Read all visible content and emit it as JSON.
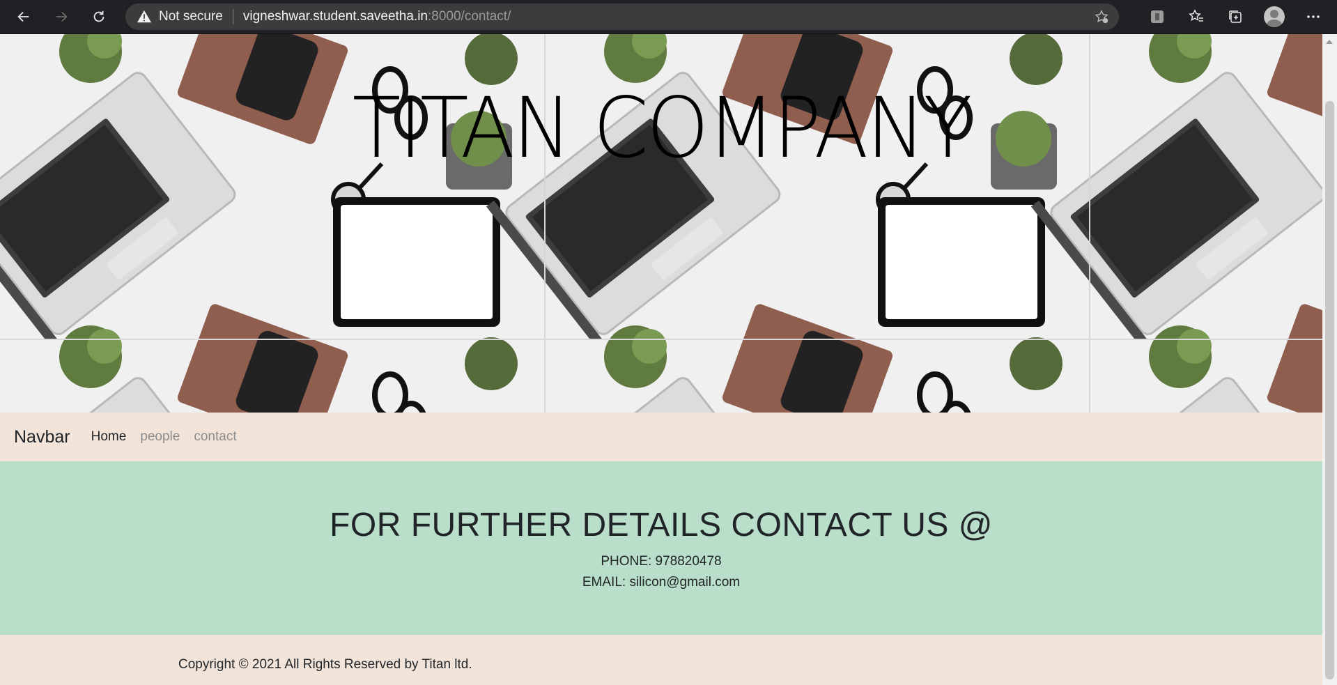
{
  "browser": {
    "security_label": "Not secure",
    "url_host": "vigneshwar.student.saveetha.in",
    "url_path": ":8000/contact/"
  },
  "hero": {
    "title": "TITAN COMPANY"
  },
  "navbar": {
    "brand": "Navbar",
    "links": [
      {
        "label": "Home",
        "active": true
      },
      {
        "label": "people",
        "active": false
      },
      {
        "label": "contact",
        "active": false
      }
    ]
  },
  "contact": {
    "heading": "FOR FURTHER DETAILS CONTACT US @",
    "phone": "PHONE: 978820478",
    "email": "EMAIL: silicon@gmail.com"
  },
  "footer": {
    "copyright": "Copyright © 2021 All Rights Reserved by Titan ltd."
  },
  "colors": {
    "navbar_bg": "#f2e4d9",
    "contact_bg": "#b9dec9",
    "chrome_bg": "#202124"
  }
}
